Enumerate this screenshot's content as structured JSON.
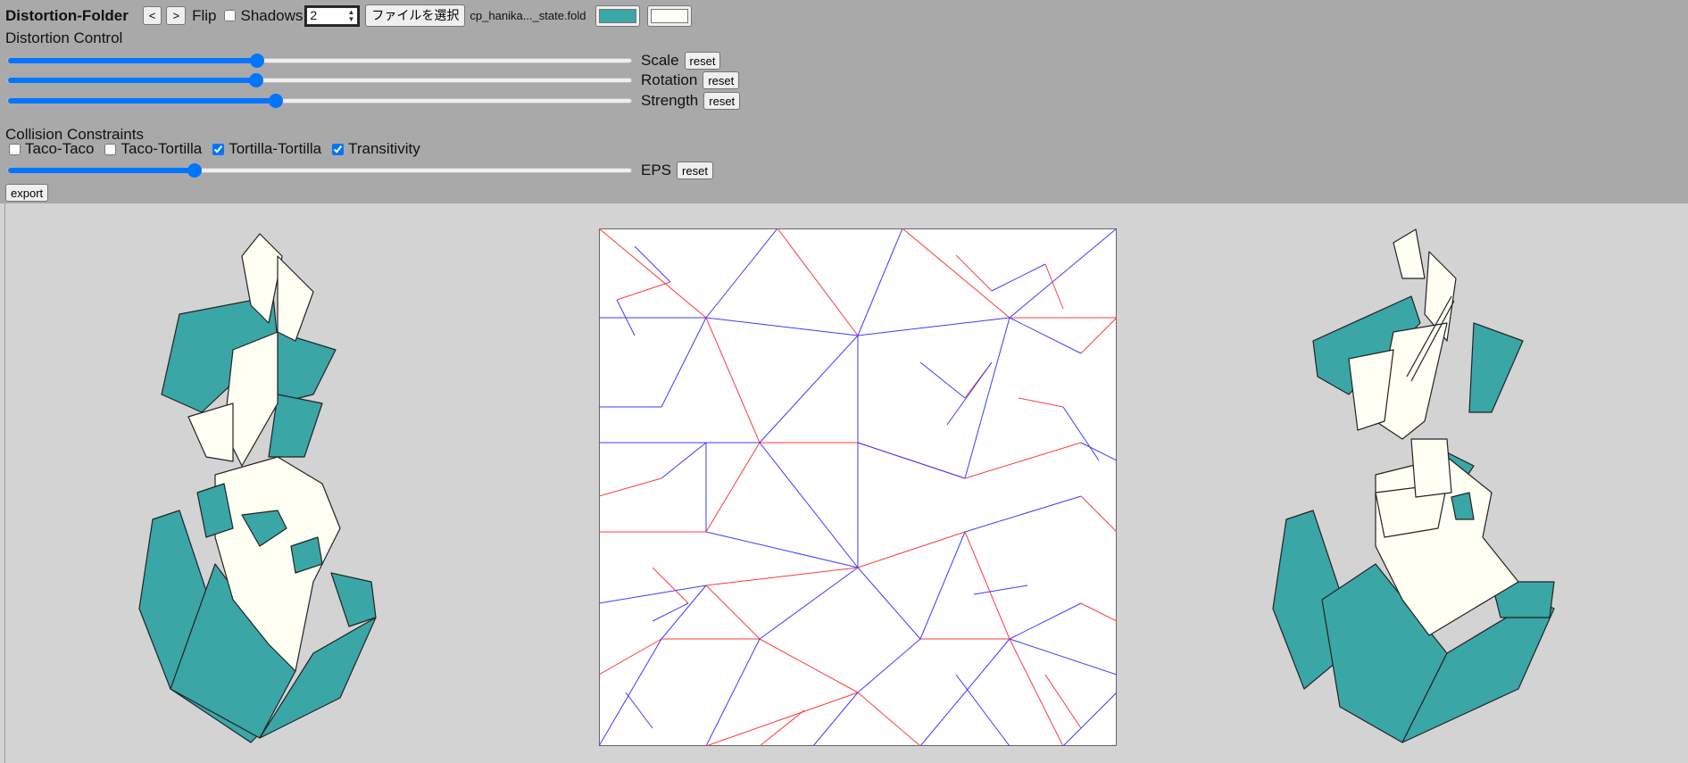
{
  "header": {
    "title": "Distortion-Folder",
    "prev_label": "<",
    "next_label": ">",
    "flip_label": "Flip",
    "shadows_label": "Shadows",
    "shadows_checked": false,
    "shadows_value": "2",
    "file_button_label": "ファイルを選択",
    "file_name": "cp_hanika..._state.fold",
    "front_color": "#3aa6a6",
    "back_color": "#fffff4"
  },
  "distortion": {
    "heading": "Distortion Control",
    "sliders": [
      {
        "label": "Scale",
        "value": 0.4,
        "reset_label": "reset"
      },
      {
        "label": "Rotation",
        "value": 0.398,
        "reset_label": "reset"
      },
      {
        "label": "Strength",
        "value": 0.43,
        "reset_label": "reset"
      }
    ]
  },
  "collision": {
    "heading": "Collision Constraints",
    "options": [
      {
        "label": "Taco-Taco",
        "checked": false
      },
      {
        "label": "Taco-Tortilla",
        "checked": false
      },
      {
        "label": "Tortilla-Tortilla",
        "checked": true
      },
      {
        "label": "Transitivity",
        "checked": true
      }
    ],
    "eps": {
      "label": "EPS",
      "value": 0.3,
      "reset_label": "reset"
    }
  },
  "export_label": "export",
  "colors": {
    "mountain": "#ff3b3b",
    "valley": "#3b3bff",
    "panel_bg": "#a9a9a9",
    "view_bg": "#d3d3d3"
  }
}
